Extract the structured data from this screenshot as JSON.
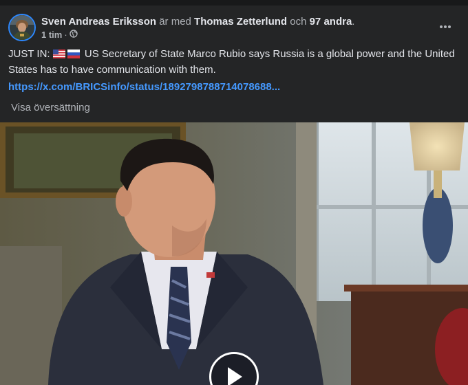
{
  "post": {
    "author": "Sven Andreas Eriksson",
    "with_text": "är med",
    "tagged": "Thomas Zetterlund",
    "and_text": "och",
    "others": "97 andra",
    "period": ".",
    "time": "1 tim",
    "separator": "·",
    "audience_icon": "globe-icon",
    "more_icon": "more-options-icon",
    "text_prefix": "JUST IN:",
    "flags": [
      "us-flag-icon",
      "russia-flag-icon"
    ],
    "text_body": "US Secretary of State Marco Rubio says Russia is a global power and the United States has to have communication with them.",
    "link": "https://x.com/BRICSinfo/status/1892798788714078688...",
    "translate_label": "Visa översättning"
  },
  "video": {
    "play_icon": "play-icon"
  },
  "colors": {
    "card_bg": "#242526",
    "text_primary": "#e4e6eb",
    "text_secondary": "#b0b3b8",
    "link": "#4599ff",
    "avatar_ring": "#2d88ff"
  }
}
